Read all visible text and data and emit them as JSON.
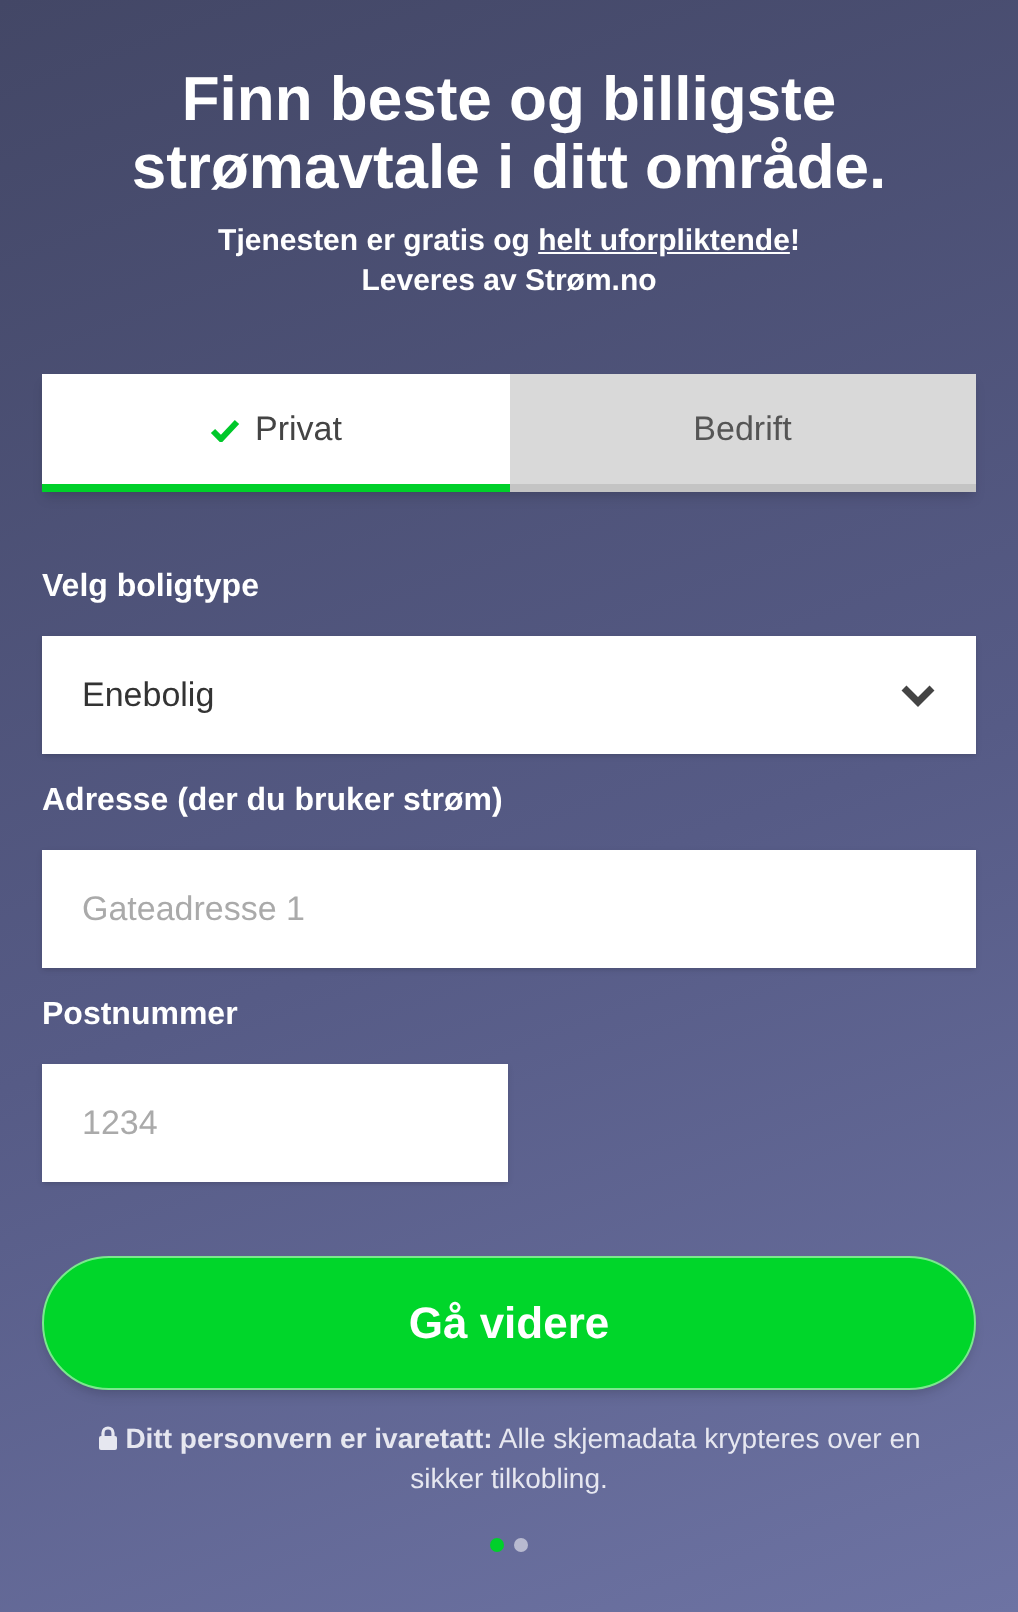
{
  "headline": "Finn beste og billigste strømavtale i ditt område.",
  "subtitle": {
    "before": "Tjenesten er gratis og ",
    "link": "helt uforpliktende",
    "after": "!"
  },
  "provider": "Leveres av Strøm.no",
  "tabs": [
    {
      "label": "Privat",
      "selected": true
    },
    {
      "label": "Bedrift",
      "selected": false
    }
  ],
  "housing": {
    "label": "Velg boligtype",
    "value": "Enebolig"
  },
  "address": {
    "label": "Adresse (der du bruker strøm)",
    "placeholder": "Gateadresse 1"
  },
  "postcode": {
    "label": "Postnummer",
    "placeholder": "1234"
  },
  "submit": "Gå videre",
  "privacy": "**Ditt personvern er ivaretatt:** Alle skjemadata krypteres over en sikker tilkobling.",
  "pages": [
    {
      "selected": true
    },
    {
      "selected": false
    }
  ]
}
